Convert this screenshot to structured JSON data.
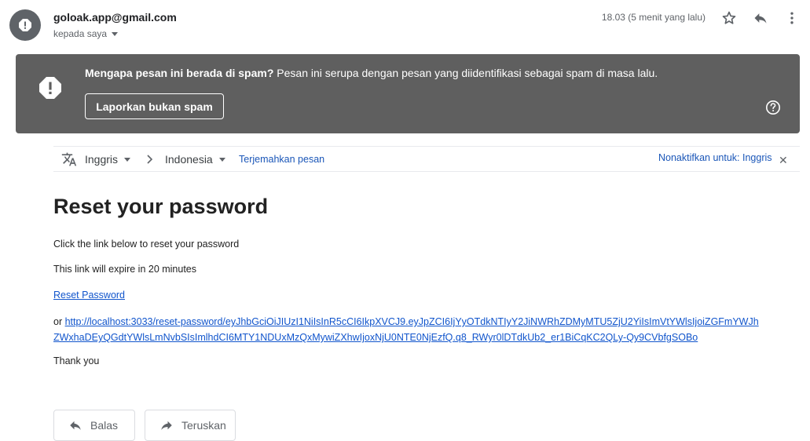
{
  "header": {
    "sender": "goloak.app@gmail.com",
    "recipient": "kepada saya",
    "timestamp": "18.03 (5 menit yang lalu)"
  },
  "spam_banner": {
    "question": "Mengapa pesan ini berada di spam?",
    "explanation": " Pesan ini serupa dengan pesan yang diidentifikasi sebagai spam di masa lalu.",
    "report_button": "Laporkan bukan spam"
  },
  "translate": {
    "source_lang": "Inggris",
    "target_lang": "Indonesia",
    "translate_link": "Terjemahkan pesan",
    "disable_link": "Nonaktifkan untuk: Inggris"
  },
  "body": {
    "title": "Reset your password",
    "line1": "Click the link below to reset your password",
    "line2": "This link will expire in 20 minutes",
    "reset_link": "Reset Password",
    "or_text": "or ",
    "url": "http://localhost:3033/reset-password/eyJhbGciOiJIUzI1NiIsInR5cCI6IkpXVCJ9.eyJpZCI6IjYyOTdkNTIyY2JiNWRhZDMyMTU5ZjU2YiIsImVtYWlsIjoiZGFmYWJhZWxhaDEyQGdtYWlsLmNvbSIsImlhdCI6MTY1NDUxMzQxMywiZXhwIjoxNjU0NTE0NjEzfQ.q8_RWyr0lDTdkUb2_er1BiCqKC2QLy-Qy9CVbfgSOBo",
    "closing": "Thank you"
  },
  "actions": {
    "reply": "Balas",
    "forward": "Teruskan"
  },
  "colors": {
    "banner": "#5f5f5f",
    "link": "#1155cc",
    "avatar": "#5f6368"
  }
}
